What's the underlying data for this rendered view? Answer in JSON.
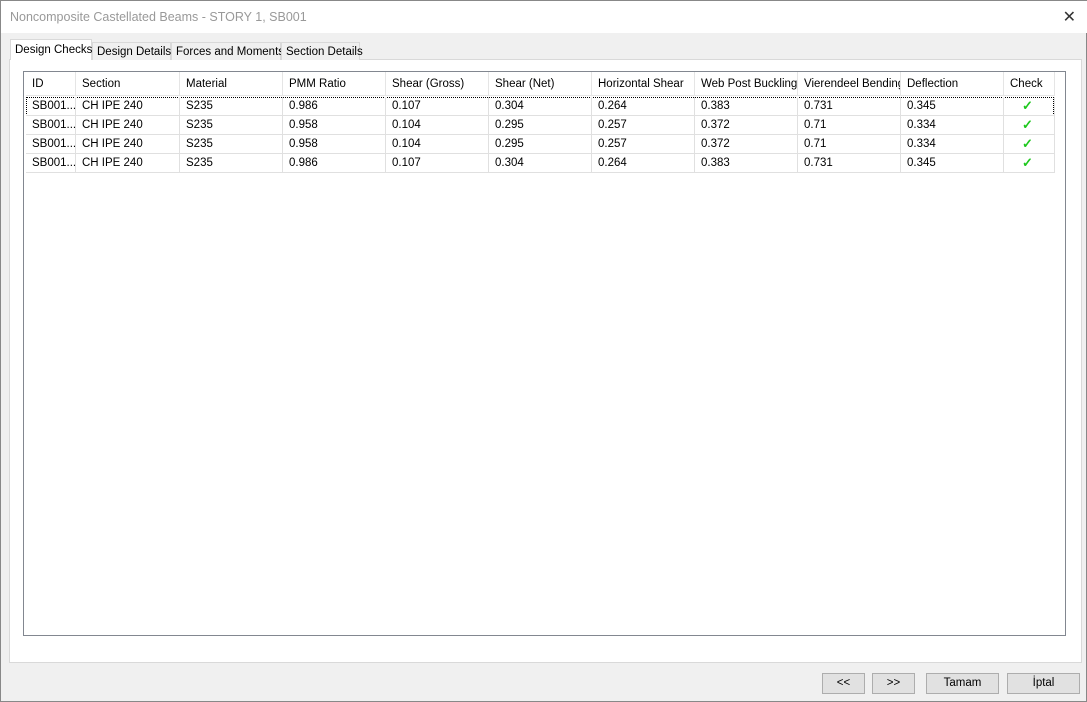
{
  "window": {
    "title": "Noncomposite Castellated Beams - STORY 1, SB001",
    "close": "✕"
  },
  "tabs": [
    {
      "label": "Design Checks"
    },
    {
      "label": "Design Details"
    },
    {
      "label": "Forces and Moments"
    },
    {
      "label": "Section Details"
    }
  ],
  "table": {
    "columns": [
      "ID",
      "Section",
      "Material",
      "PMM Ratio",
      "Shear (Gross)",
      "Shear (Net)",
      "Horizontal Shear",
      "Web Post Buckling",
      "Vierendeel Bending",
      "Deflection",
      "Check"
    ],
    "rows": [
      [
        "SB001...",
        "CH IPE 240",
        "S235",
        "0.986",
        "0.107",
        "0.304",
        "0.264",
        "0.383",
        "0.731",
        "0.345",
        "✓"
      ],
      [
        "SB001...",
        "CH IPE 240",
        "S235",
        "0.958",
        "0.104",
        "0.295",
        "0.257",
        "0.372",
        "0.71",
        "0.334",
        "✓"
      ],
      [
        "SB001...",
        "CH IPE 240",
        "S235",
        "0.958",
        "0.104",
        "0.295",
        "0.257",
        "0.372",
        "0.71",
        "0.334",
        "✓"
      ],
      [
        "SB001...",
        "CH IPE 240",
        "S235",
        "0.986",
        "0.107",
        "0.304",
        "0.264",
        "0.383",
        "0.731",
        "0.345",
        "✓"
      ]
    ],
    "check_color": "#1ec81e"
  },
  "buttons": {
    "prev": "<<",
    "next": ">>",
    "ok": "Tamam",
    "cancel": "İptal"
  }
}
